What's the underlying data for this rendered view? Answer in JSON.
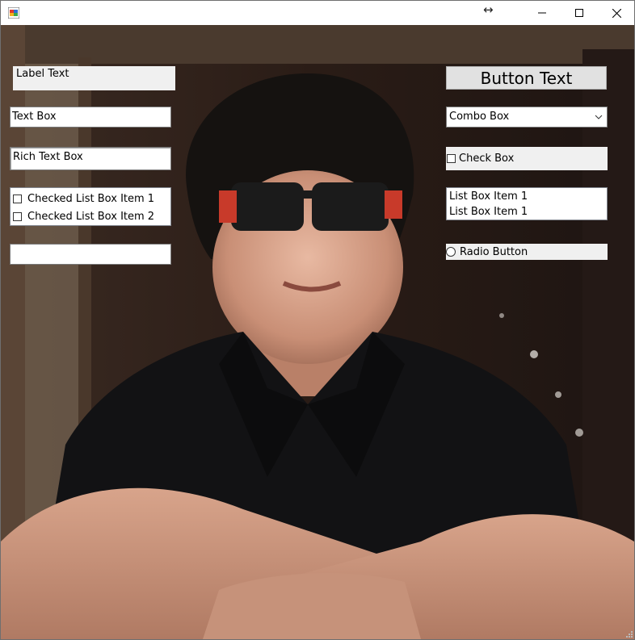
{
  "window": {
    "title": "",
    "icon": "form-icon",
    "controls": [
      "minimize-icon",
      "maximize-icon",
      "close-icon"
    ]
  },
  "left_panel": {
    "label_text": "Label Text",
    "text_box_value": "Text Box",
    "rich_text_box_value": "Rich Text Box",
    "checked_list_items": [
      {
        "label": "Checked List Box Item 1",
        "checked": false
      },
      {
        "label": "Checked List Box Item 2",
        "checked": false
      }
    ],
    "empty_text_box_value": ""
  },
  "right_panel": {
    "button_label": "Button Text",
    "combo_box_value": "Combo Box",
    "check_box_label": "Check Box",
    "check_box_checked": false,
    "list_box_items": [
      "List Box Item 1",
      "List Box Item 1"
    ],
    "radio_button_label": "Radio Button",
    "radio_selected": false
  },
  "colors": {
    "control_face": "#f0f0f0",
    "button_face": "#e1e1e1",
    "border": "#7a7a7a"
  }
}
